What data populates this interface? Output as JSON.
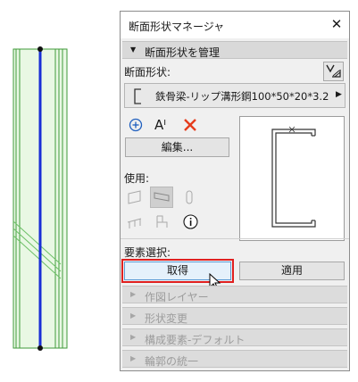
{
  "dialog": {
    "title": "断面形状マネージャ",
    "close_glyph": "✕"
  },
  "manage_section": {
    "label": "断面形状を管理",
    "profile_label": "断面形状:",
    "profile_value": "鉄骨梁-リップ溝形鋼100*50*20*3.2",
    "edit_button": "編集...",
    "usage_label": "使用:",
    "text_icon_label": "Aᴵ"
  },
  "element_select": {
    "label": "要素選択:",
    "pick_button": "取得",
    "apply_button": "適用"
  },
  "collapsed_sections": [
    {
      "label": "作図レイヤー"
    },
    {
      "label": "形状変更"
    },
    {
      "label": "構成要素-デフォルト"
    },
    {
      "label": "輪郭の統一"
    }
  ],
  "colors": {
    "accent_blue": "#1f5fbf",
    "beam_blue": "#1a2fd6",
    "highlight_red": "#e02020",
    "delete_red": "#e53c1c",
    "fill_green": "#e9f8e4",
    "line_green": "#3f9a3a"
  },
  "icons": [
    "chevron-right-icon",
    "triangle-down-icon",
    "add-icon",
    "delete-icon",
    "info-icon",
    "cursor-icon",
    "profile-manager-icon"
  ]
}
